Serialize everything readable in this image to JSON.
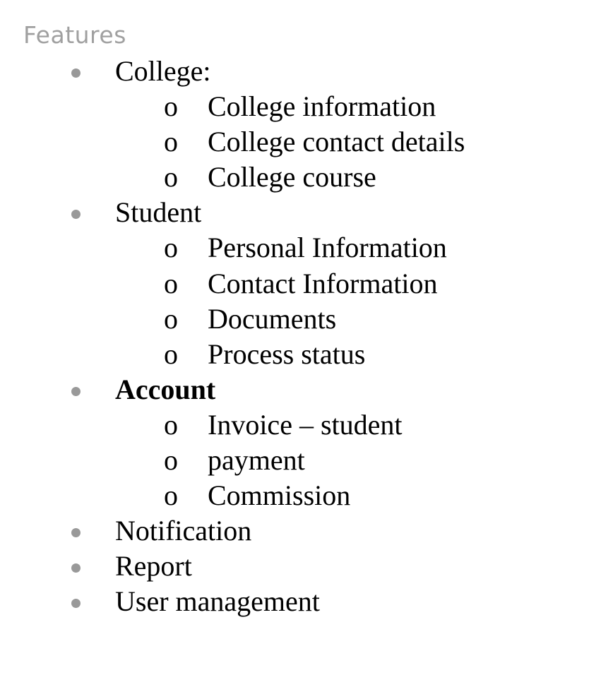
{
  "heading": "Features",
  "bullet_symbols": {
    "top": "filled-dot",
    "sub": "o"
  },
  "colors": {
    "heading": "#a0a0a0",
    "text": "#000000",
    "bullet": "#999999"
  },
  "features": [
    {
      "label": "College:",
      "bold": false,
      "children": [
        "College information",
        "College contact details",
        "College course"
      ]
    },
    {
      "label": "Student",
      "bold": false,
      "children": [
        "Personal Information",
        "Contact Information",
        "Documents",
        "Process status"
      ]
    },
    {
      "label": "Account",
      "bold": true,
      "children": [
        "Invoice – student",
        "payment",
        "Commission"
      ]
    },
    {
      "label": "Notification",
      "bold": false,
      "children": []
    },
    {
      "label": "Report",
      "bold": false,
      "children": []
    },
    {
      "label": "User management",
      "bold": false,
      "children": []
    }
  ]
}
